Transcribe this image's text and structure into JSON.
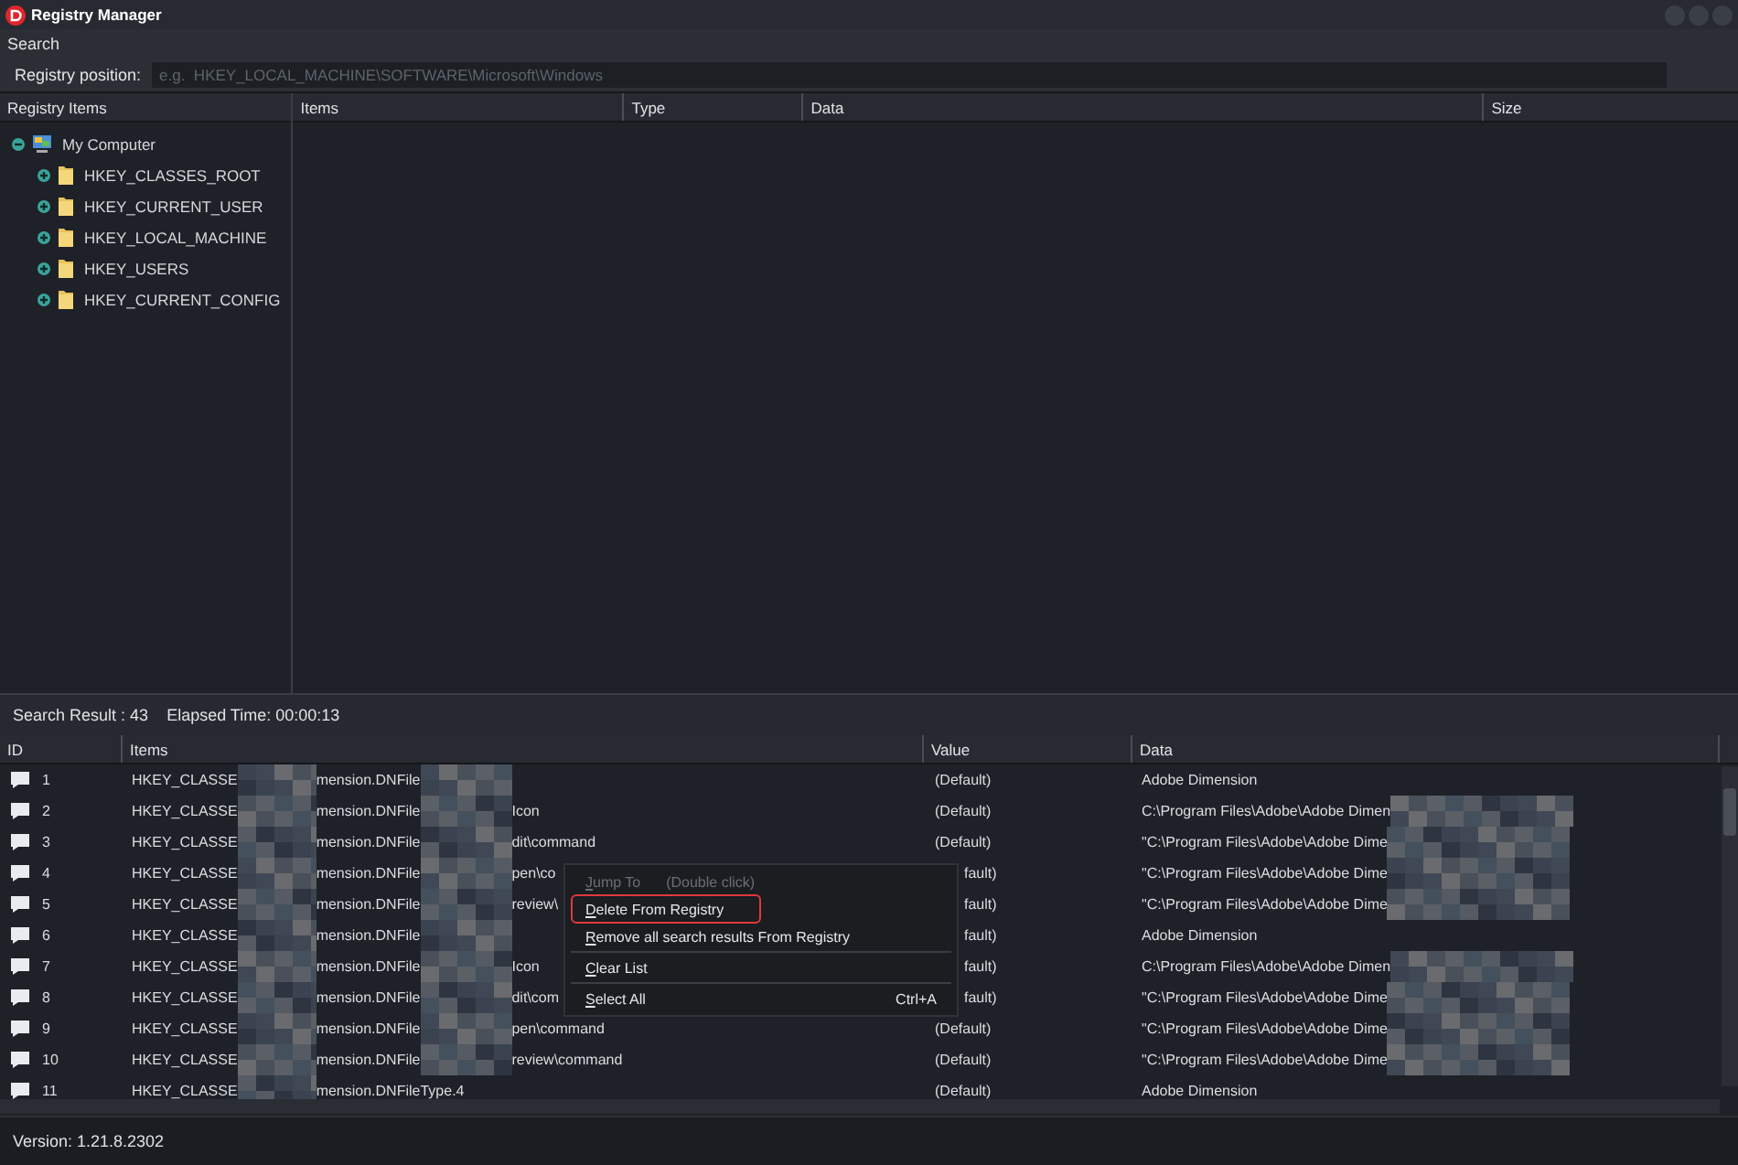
{
  "window": {
    "title": "Registry Manager"
  },
  "menu": [
    "Search"
  ],
  "position": {
    "label": "Registry position:",
    "placeholder": "e.g.  HKEY_LOCAL_MACHINE\\SOFTWARE\\Microsoft\\Windows"
  },
  "tree": {
    "title": "Registry Items",
    "root": {
      "label": "My Computer",
      "expanded": true,
      "children": [
        {
          "label": "HKEY_CLASSES_ROOT",
          "expanded": false
        },
        {
          "label": "HKEY_CURRENT_USER",
          "expanded": false
        },
        {
          "label": "HKEY_LOCAL_MACHINE",
          "expanded": false
        },
        {
          "label": "HKEY_USERS",
          "expanded": false
        },
        {
          "label": "HKEY_CURRENT_CONFIG",
          "expanded": false
        }
      ]
    }
  },
  "items_table": {
    "columns": [
      "Items",
      "Type",
      "Data",
      "Size"
    ]
  },
  "results": {
    "summary_label": "Search Result :",
    "count": "43",
    "elapsed_label": "Elapsed Time:",
    "elapsed": "00:00:13",
    "columns": [
      "ID",
      "Items",
      "Value",
      "Data"
    ],
    "rows": [
      {
        "id": "1",
        "item_start": "HKEY_CLASSE",
        "item_mid": "mension.DNFile",
        "item_end": "",
        "value": "(Default)",
        "data": "Adobe Dimension",
        "data_hidden": false
      },
      {
        "id": "2",
        "item_start": "HKEY_CLASSE",
        "item_mid": "mension.DNFile",
        "item_end": "Icon",
        "value": "(Default)",
        "data": "C:\\Program Files\\Adobe\\Adobe Dimen",
        "data_hidden": true
      },
      {
        "id": "3",
        "item_start": "HKEY_CLASSE",
        "item_mid": "mension.DNFile",
        "item_end": "dit\\command",
        "value": "(Default)",
        "data": "\"C:\\Program Files\\Adobe\\Adobe Dime",
        "data_hidden": true
      },
      {
        "id": "4",
        "item_start": "HKEY_CLASSE",
        "item_mid": "mension.DNFile",
        "item_end": "pen\\co",
        "value": "fault)",
        "data": "\"C:\\Program Files\\Adobe\\Adobe Dime",
        "data_hidden": true
      },
      {
        "id": "5",
        "item_start": "HKEY_CLASSE",
        "item_mid": "mension.DNFile",
        "item_end": "review\\",
        "value": "fault)",
        "data": "\"C:\\Program Files\\Adobe\\Adobe Dime",
        "data_hidden": true
      },
      {
        "id": "6",
        "item_start": "HKEY_CLASSE",
        "item_mid": "mension.DNFile",
        "item_end": "",
        "value": "fault)",
        "data": "Adobe Dimension",
        "data_hidden": false
      },
      {
        "id": "7",
        "item_start": "HKEY_CLASSE",
        "item_mid": "mension.DNFile",
        "item_end": "Icon",
        "value": "fault)",
        "data": "C:\\Program Files\\Adobe\\Adobe Dimen",
        "data_hidden": true
      },
      {
        "id": "8",
        "item_start": "HKEY_CLASSE",
        "item_mid": "mension.DNFile",
        "item_end": "dit\\com",
        "value": "fault)",
        "data": "\"C:\\Program Files\\Adobe\\Adobe Dime",
        "data_hidden": true
      },
      {
        "id": "9",
        "item_start": "HKEY_CLASSE",
        "item_mid": "mension.DNFile",
        "item_end": "pen\\command",
        "value": "(Default)",
        "data": "\"C:\\Program Files\\Adobe\\Adobe Dime",
        "data_hidden": true
      },
      {
        "id": "10",
        "item_start": "HKEY_CLASSE",
        "item_mid": "mension.DNFile",
        "item_end": "review\\command",
        "value": "(Default)",
        "data": "\"C:\\Program Files\\Adobe\\Adobe Dime",
        "data_hidden": true
      },
      {
        "id": "11",
        "item_start": "HKEY_CLASSE",
        "item_mid": "mension.DNFileType.4",
        "item_end": "",
        "value": "(Default)",
        "data": "Adobe Dimension",
        "data_hidden": false
      }
    ]
  },
  "context_menu": [
    {
      "kind": "item",
      "label": "Jump To",
      "hint": "(Double click)",
      "disabled": true,
      "highlighted": false
    },
    {
      "kind": "item",
      "label": "Delete From Registry",
      "disabled": false,
      "highlighted": true
    },
    {
      "kind": "item",
      "label": "Remove all search results From Registry",
      "disabled": false,
      "highlighted": false
    },
    {
      "kind": "separator"
    },
    {
      "kind": "item",
      "label": "Clear List",
      "disabled": false,
      "highlighted": false
    },
    {
      "kind": "separator"
    },
    {
      "kind": "item",
      "label": "Select All",
      "shortcut": "Ctrl+A",
      "disabled": false,
      "highlighted": false
    }
  ],
  "status_bar": {
    "version": "Version: 1.21.8.2302"
  }
}
